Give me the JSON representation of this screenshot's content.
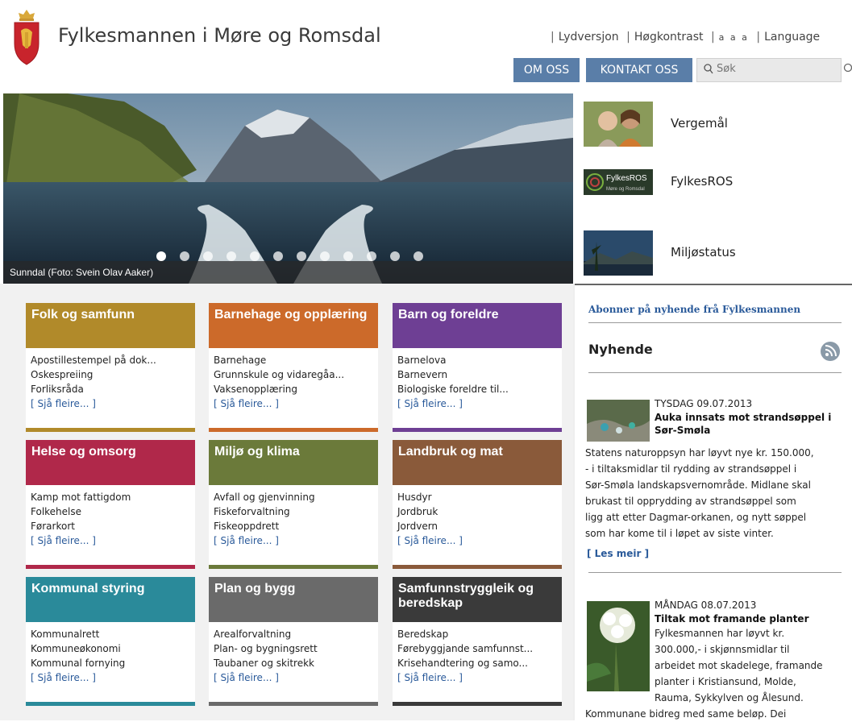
{
  "header": {
    "title": "Fylkesmannen i Møre og Romsdal",
    "links": [
      "Lydversjon",
      "Høgkontrast",
      "a a a",
      "Language"
    ],
    "nav": [
      "OM OSS",
      "KONTAKT OSS"
    ],
    "search_placeholder": "Søk",
    "crest_icon": "coat-of-arms-icon"
  },
  "hero": {
    "caption": "Sunndal (Foto: Svein Olav Aaker)",
    "slide_count": 12,
    "active_slide": 1
  },
  "side_links": [
    {
      "label": "Vergemål"
    },
    {
      "label": "FylkesROS",
      "badge_line1": "FylkesROS",
      "badge_line2": "Møre og Romsdal"
    },
    {
      "label": "Miljøstatus"
    }
  ],
  "tiles": [
    {
      "title": "Folk og samfunn",
      "color": "#b18a2a",
      "items": [
        "Apostillestempel på dok...",
        "Oskespreiing",
        "Forliksråda"
      ],
      "more": "[ Sjå fleire... ]"
    },
    {
      "title": "Barnehage og opplæring",
      "color": "#cc6a2a",
      "items": [
        "Barnehage",
        "Grunnskule og vidaregåa...",
        "Vaksenopplæring"
      ],
      "more": "[ Sjå fleire... ]"
    },
    {
      "title": "Barn og foreldre",
      "color": "#6e3f94",
      "items": [
        "Barnelova",
        "Barnevern",
        "Biologiske foreldre til..."
      ],
      "more": "[ Sjå fleire... ]"
    },
    {
      "title": "Helse og omsorg",
      "color": "#b0284a",
      "items": [
        "Kamp mot fattigdom",
        "Folkehelse",
        "Førarkort"
      ],
      "more": "[ Sjå fleire... ]"
    },
    {
      "title": "Miljø og klima",
      "color": "#6b7a3a",
      "items": [
        "Avfall og gjenvinning",
        "Fiskeforvaltning",
        "Fiskeoppdrett"
      ],
      "more": "[ Sjå fleire... ]"
    },
    {
      "title": "Landbruk og mat",
      "color": "#8a5a3a",
      "items": [
        "Husdyr",
        "Jordbruk",
        "Jordvern"
      ],
      "more": "[ Sjå fleire... ]"
    },
    {
      "title": "Kommunal styring",
      "color": "#2a8a9a",
      "items": [
        "Kommunalrett",
        "Kommuneøkonomi",
        "Kommunal fornying"
      ],
      "more": "[ Sjå fleire... ]"
    },
    {
      "title": "Plan og bygg",
      "color": "#6a6a6a",
      "items": [
        "Arealforvaltning",
        "Plan- og bygningsrett",
        "Taubaner og skitrekk"
      ],
      "more": "[ Sjå fleire... ]"
    },
    {
      "title": "Samfunnstryggleik og beredskap",
      "color": "#3a3a3a",
      "items": [
        "Beredskap",
        "Førebyggjande samfunnst...",
        "Krisehandtering og samo..."
      ],
      "more": "[ Sjå fleire... ]"
    }
  ],
  "news": {
    "subscribe": "Abonner på nyhende frå Fylkesmannen",
    "heading": "Nyhende",
    "articles": [
      {
        "date": "TYSDAG 09.07.2013",
        "headline": "Auka innsats mot strandsøppel i Sør-Smøla",
        "lines": [
          "Statens naturoppsyn har løyvt nye kr. 150.000,",
          "- i tiltaksmidlar til rydding av strandsøppel i",
          "Sør-Smøla landskapsvernområde. Midlane skal",
          "brukast til opprydding av strandsøppel som",
          "ligg att etter Dagmar-orkanen, og nytt søppel",
          "som har kome til i løpet av siste vinter."
        ],
        "more": "[ Les meir ]"
      },
      {
        "date": "MÅNDAG 08.07.2013",
        "headline": "Tiltak mot framande planter",
        "lines": [
          "Fylkesmannen har løyvt kr.",
          "300.000,- i skjønnsmidlar til",
          "arbeidet mot skadelege, framande",
          "planter i Kristiansund, Molde,",
          "Rauma, Sykkylven og Ålesund.",
          "Kommunane bidreg med same beløp. Dei"
        ]
      }
    ]
  }
}
